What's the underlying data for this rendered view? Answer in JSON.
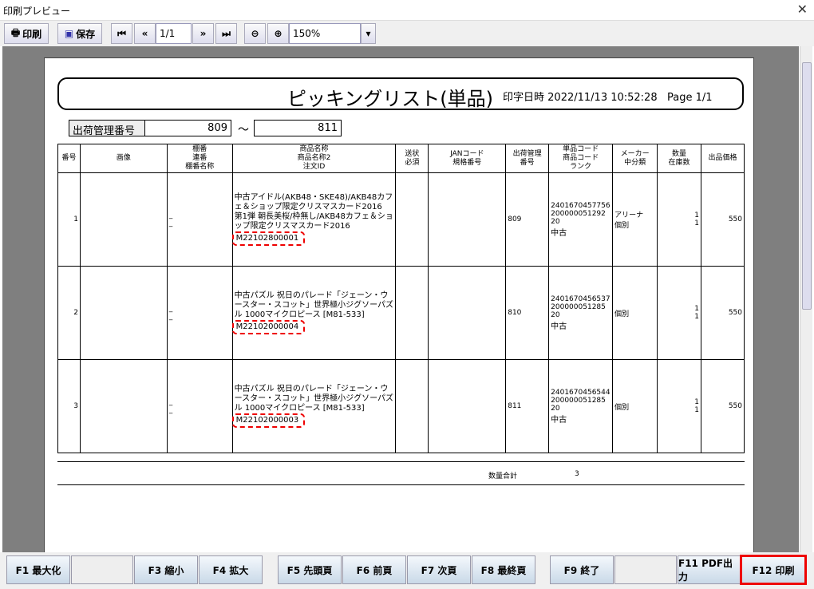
{
  "window": {
    "title": "印刷プレビュー",
    "close": "✕"
  },
  "toolbar": {
    "print": "印刷",
    "save": "保存",
    "page": "1/1",
    "zoom": "150%"
  },
  "report": {
    "title": "ピッキングリスト(単品)",
    "printed_label": "印字日時",
    "printed": "2022/11/13 10:52:28",
    "page": "Page 1/1",
    "range_label": "出荷管理番号",
    "range_from": "809",
    "range_sep": "～",
    "range_to": "811",
    "headers": [
      "番号",
      "画像",
      "棚番\n連番\n棚番名称",
      "商品名称\n商品名称2\n注文ID",
      "送状\n必須",
      "JANコード\n規格番号",
      "出荷管理\n番号",
      "単品コード\n商品コード\nランク",
      "メーカー\n中分類",
      "数量\n在庫数",
      "出品価格"
    ],
    "rows": [
      {
        "no": "1",
        "tana": "_\n_",
        "name": "中古アイドル(AKB48・SKE48)/AKB48カフェ＆ショップ限定クリスマスカード2016　第1弾 朝長美桜/枠無し/AKB48カフェ＆ショップ限定クリスマスカード2016",
        "order_id": "M22102800001",
        "ship": "809",
        "codes": "2401670457756\n200000051292\n20",
        "rank": "中古",
        "maker": "アリーナ\n個別",
        "qty": "1\n1",
        "price": "550"
      },
      {
        "no": "2",
        "tana": "_\n_",
        "name": "中古パズル 祝日のパレード「ジェーン・ウースター・スコット」世界極小ジグソーパズル 1000マイクロピース [M81-533]",
        "order_id": "M22102000004",
        "ship": "810",
        "codes": "2401670456537\n200000051285\n20",
        "rank": "中古",
        "maker": "個別",
        "qty": "1\n1",
        "price": "550"
      },
      {
        "no": "3",
        "tana": "_\n_",
        "name": "中古パズル 祝日のパレード「ジェーン・ウースター・スコット」世界極小ジグソーパズル 1000マイクロピース [M81-533]",
        "order_id": "M22102000003",
        "ship": "811",
        "codes": "2401670456544\n200000051285\n20",
        "rank": "中古",
        "maker": "個別",
        "qty": "1\n1",
        "price": "550"
      }
    ],
    "total_label": "数量合計",
    "total": "3"
  },
  "footer": {
    "f1": "F1 最大化",
    "f3": "F3 縮小",
    "f4": "F4 拡大",
    "f5": "F5 先頭頁",
    "f6": "F6 前頁",
    "f7": "F7 次頁",
    "f8": "F8 最終頁",
    "f9": "F9 終了",
    "f11": "F11 PDF出力",
    "f12": "F12 印刷"
  },
  "highlight_color": "#e00000"
}
